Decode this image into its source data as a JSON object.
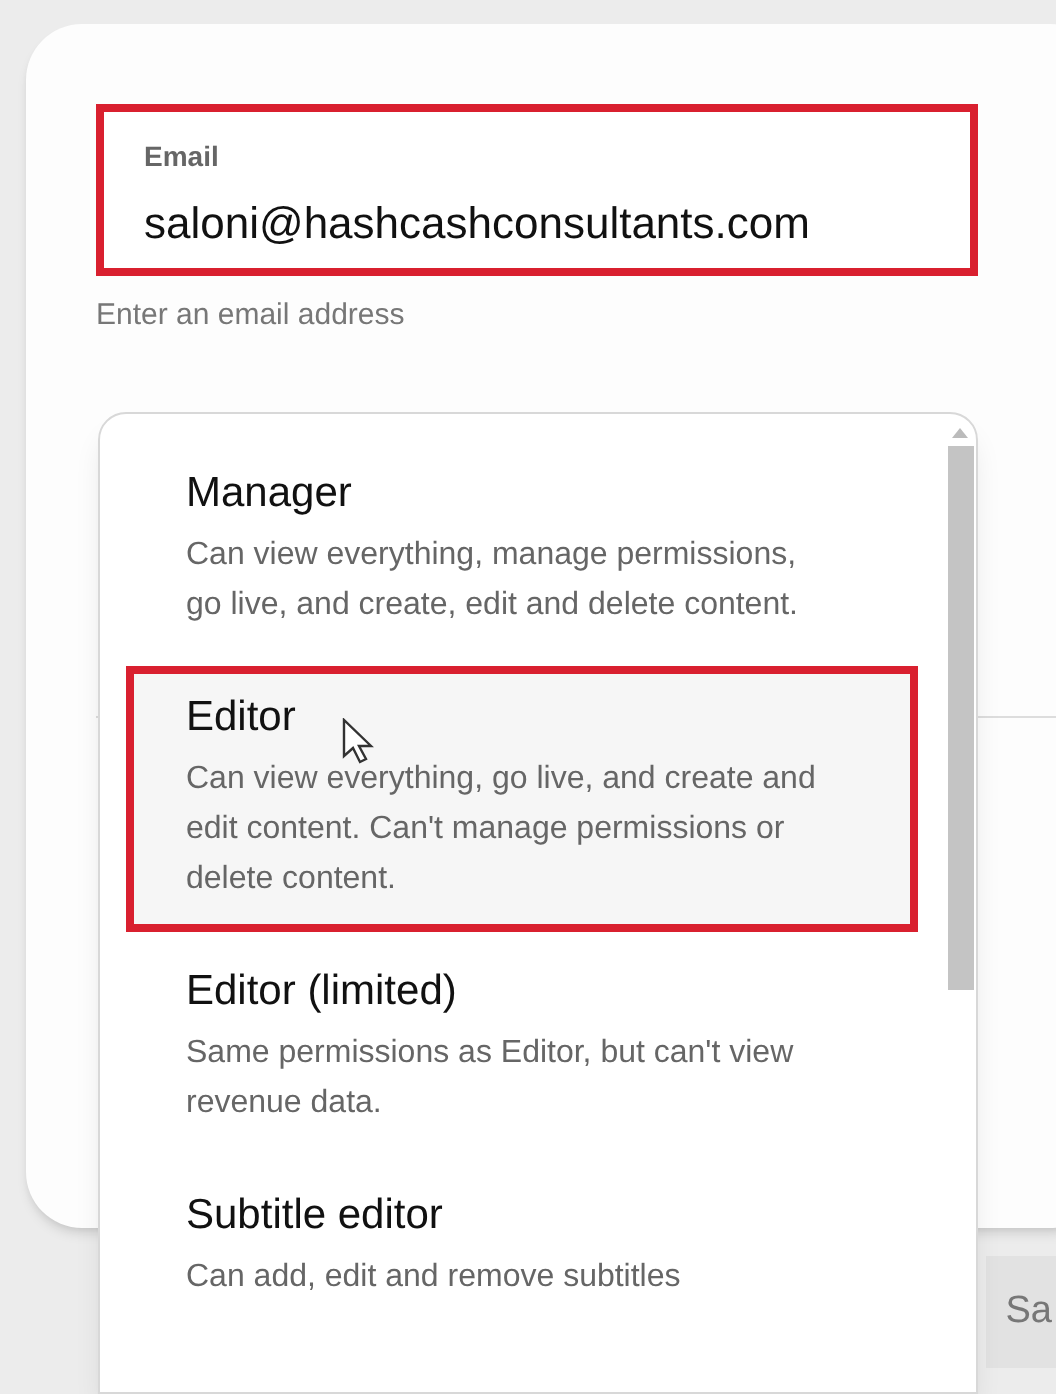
{
  "email_field": {
    "label": "Email",
    "value": "saloni@hashcashconsultants.com",
    "annotated": true,
    "helper": "Enter an email address"
  },
  "role_menu": {
    "items": [
      {
        "title": "Manager",
        "description": "Can view everything, manage permissions, go live, and create, edit and delete content.",
        "selected": false,
        "annotated": false
      },
      {
        "title": "Editor",
        "description": "Can view everything, go live, and create and edit content. Can't manage permissions or delete content.",
        "selected": true,
        "annotated": true
      },
      {
        "title": "Editor (limited)",
        "description": "Same permissions as Editor, but can't view revenue data.",
        "selected": false,
        "annotated": false
      },
      {
        "title": "Subtitle editor",
        "description": "Can add, edit and remove subtitles",
        "selected": false,
        "annotated": false
      }
    ]
  },
  "footer_button": "Sa"
}
